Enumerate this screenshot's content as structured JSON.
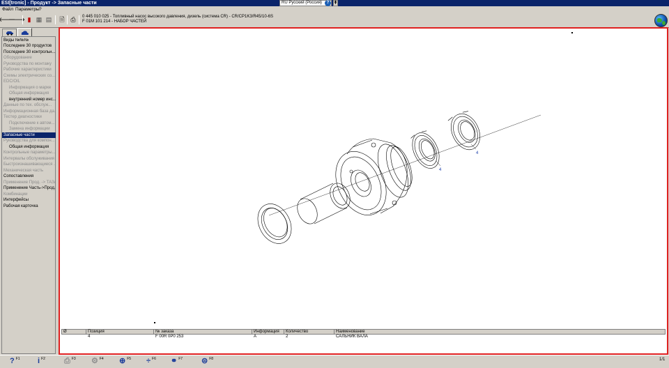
{
  "window": {
    "title": "ESI[tronic] - Продукт -> Запасные части",
    "language": "RU Русский (Россия)"
  },
  "menu": [
    "Файл",
    "Параметры",
    "?"
  ],
  "toolbar": {
    "product_line1": "0 445 010 025 - Топливный насос высокого давления, дизель (система CR) - CR/CP1K3/R45/10-6S",
    "product_line2": "F 01M 101 214 - НАБОР ЧАСТЕЙ"
  },
  "sidebar": {
    "items": [
      {
        "label": "Виды №№№",
        "dim": false,
        "indent": false,
        "selected": false
      },
      {
        "label": "Последние 30 продуктов",
        "dim": false,
        "indent": false,
        "selected": false
      },
      {
        "label": "Последние 30 контрольн...",
        "dim": false,
        "indent": false,
        "selected": false
      },
      {
        "label": "Оборудование",
        "dim": true,
        "indent": false,
        "selected": false
      },
      {
        "label": "Руководства по монтажу",
        "dim": true,
        "indent": false,
        "selected": false
      },
      {
        "label": "Рабочие характеристики",
        "dim": true,
        "indent": false,
        "selected": false
      },
      {
        "label": "Схемы электрических со...",
        "dim": true,
        "indent": false,
        "selected": false
      },
      {
        "label": "EDC/OIL",
        "dim": true,
        "indent": false,
        "selected": false
      },
      {
        "label": "Информация о марке",
        "dim": true,
        "indent": true,
        "selected": false
      },
      {
        "label": "Общая информация",
        "dim": true,
        "indent": true,
        "selected": false
      },
      {
        "label": "внутренний номер инс...",
        "dim": false,
        "indent": true,
        "selected": false
      },
      {
        "label": "Данные по тех. обслуж...",
        "dim": true,
        "indent": false,
        "selected": false
      },
      {
        "label": "Информационная база да...",
        "dim": true,
        "indent": false,
        "selected": false
      },
      {
        "label": "Тестер диагностики",
        "dim": true,
        "indent": false,
        "selected": false
      },
      {
        "label": "Подключение к автом...",
        "dim": true,
        "indent": true,
        "selected": false
      },
      {
        "label": "Замена информации",
        "dim": true,
        "indent": true,
        "selected": false
      },
      {
        "label": "Запасные части",
        "dim": false,
        "indent": false,
        "selected": true
      },
      {
        "label": "Руководства для компон...",
        "dim": true,
        "indent": false,
        "selected": false
      },
      {
        "label": "Общая информация",
        "dim": false,
        "indent": true,
        "selected": false
      },
      {
        "label": "Контрольные параметры...",
        "dim": true,
        "indent": false,
        "selected": false
      },
      {
        "label": "Интервалы обслуживания",
        "dim": true,
        "indent": false,
        "selected": false
      },
      {
        "label": "Быстроизнашивающиеся ...",
        "dim": true,
        "indent": false,
        "selected": false
      },
      {
        "label": "Механическая часть",
        "dim": true,
        "indent": false,
        "selected": false
      },
      {
        "label": "Сопоставления",
        "dim": false,
        "indent": false,
        "selected": false
      },
      {
        "label": "Применение Прод. -> ТАЗь",
        "dim": true,
        "indent": false,
        "selected": false
      },
      {
        "label": "Применение Часть->Прод..",
        "dim": false,
        "indent": false,
        "selected": false
      },
      {
        "label": "Комбинации",
        "dim": true,
        "indent": false,
        "selected": false
      },
      {
        "label": "Интерфейсы",
        "dim": false,
        "indent": false,
        "selected": false
      },
      {
        "label": "Рабочая карточка",
        "dim": false,
        "indent": false,
        "selected": false
      }
    ]
  },
  "drawing": {
    "callouts": [
      "4",
      "4"
    ]
  },
  "parts_table": {
    "headers": [
      "Ø",
      "Позиция",
      "№ заказа",
      "Информация",
      "Количество",
      "Наименование"
    ],
    "rows": [
      [
        "",
        "4",
        "F 00R 0P0 253",
        "A",
        "2",
        "САЛЬНИК ВАЛА"
      ]
    ]
  },
  "statusbar": {
    "fkeys": [
      {
        "icon": "?",
        "key": "F1",
        "dim": false
      },
      {
        "icon": "i",
        "key": "F2",
        "dim": false
      },
      {
        "icon": "⎙",
        "key": "F3",
        "dim": true
      },
      {
        "icon": "⚙",
        "key": "F4",
        "dim": true
      },
      {
        "icon": "⊕",
        "key": "F5",
        "dim": false
      },
      {
        "icon": "÷",
        "key": "F6",
        "dim": false
      },
      {
        "icon": "⚭",
        "key": "F7",
        "dim": false
      },
      {
        "icon": "⊜",
        "key": "F8",
        "dim": false
      }
    ],
    "pager": "1/1"
  }
}
